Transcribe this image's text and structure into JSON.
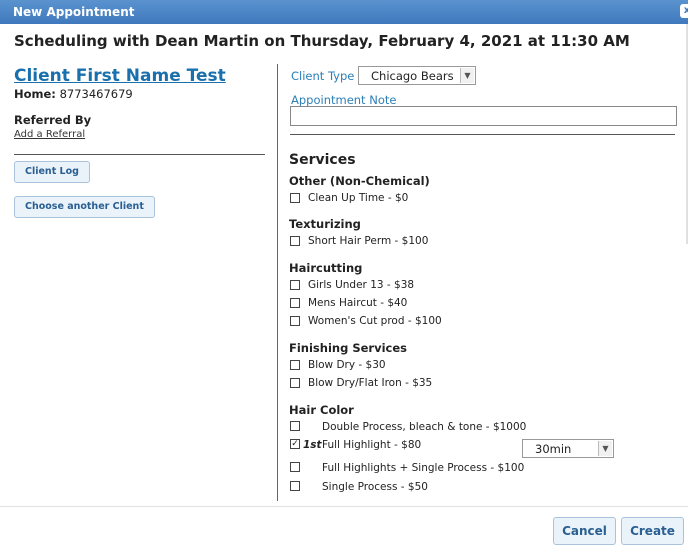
{
  "dialog": {
    "title": "New Appointment",
    "close_glyph": "x"
  },
  "heading": "Scheduling with Dean Martin on Thursday, February 4, 2021 at 11:30 AM",
  "client": {
    "name": "Client First Name Test",
    "home_label": "Home:",
    "home_phone": "8773467679",
    "referred_by_label": "Referred By",
    "add_referral": "Add a Referral",
    "client_log_button": "Client Log",
    "choose_client_button": "Choose another Client"
  },
  "form": {
    "client_type_label": "Client Type",
    "client_type_value": "Chicago Bears",
    "appointment_note_label": "Appointment Note",
    "appointment_note_value": ""
  },
  "services": {
    "title": "Services",
    "categories": [
      {
        "name": "Other (Non-Chemical)",
        "items": [
          {
            "label": "Clean Up Time - $0",
            "checked": false
          }
        ]
      },
      {
        "name": "Texturizing",
        "items": [
          {
            "label": "Short Hair Perm - $100",
            "checked": false
          }
        ]
      },
      {
        "name": "Haircutting",
        "items": [
          {
            "label": "Girls Under 13 - $38",
            "checked": false
          },
          {
            "label": "Mens Haircut - $40",
            "checked": false
          },
          {
            "label": "Women's Cut prod - $100",
            "checked": false
          }
        ]
      },
      {
        "name": "Finishing Services",
        "items": [
          {
            "label": "Blow Dry - $30",
            "checked": false
          },
          {
            "label": "Blow Dry/Flat Iron - $35",
            "checked": false
          }
        ]
      },
      {
        "name": "Hair Color",
        "items": [
          {
            "label": "Double Process, bleach & tone - $1000",
            "checked": false
          },
          {
            "label": "Full Highlight - $80",
            "checked": true,
            "order": "1st",
            "duration": "30min"
          },
          {
            "label": "Full Highlights + Single Process - $100",
            "checked": false
          },
          {
            "label": "Single Process - $50",
            "checked": false
          }
        ]
      }
    ]
  },
  "footer": {
    "cancel": "Cancel",
    "create": "Create"
  },
  "icons": {
    "checkmark": "check-icon",
    "dropdown": "chevron-down-icon"
  },
  "colors": {
    "titlebar": "#4a86c8",
    "link": "#1a6fad",
    "label": "#2b7fb8"
  }
}
